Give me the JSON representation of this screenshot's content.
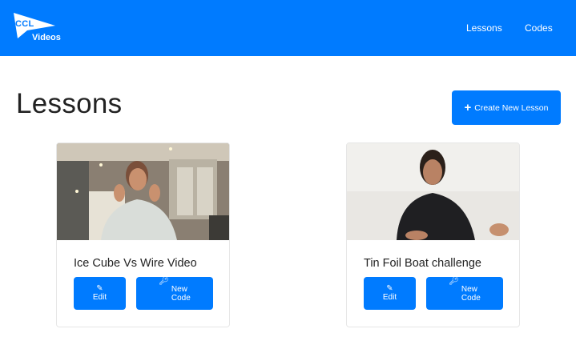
{
  "navbar": {
    "logo": {
      "top_text": "CCL",
      "bottom_text": "Videos",
      "icon": "pennant-logo"
    },
    "links": [
      {
        "label": "Lessons"
      },
      {
        "label": "Codes"
      }
    ],
    "background": "#007bff"
  },
  "page": {
    "title": "Lessons",
    "create_button": {
      "icon": "plus-icon",
      "label": "Create New Lesson"
    }
  },
  "lessons": [
    {
      "title": "Ice Cube Vs Wire Video",
      "thumbnail_icon": "video-thumbnail",
      "edit_button": {
        "icon": "edit-icon",
        "label": "Edit"
      },
      "code_button": {
        "icon": "key-icon",
        "line1": "New",
        "line2": "Code"
      }
    },
    {
      "title": "Tin Foil Boat challenge",
      "thumbnail_icon": "video-thumbnail",
      "edit_button": {
        "icon": "edit-icon",
        "label": "Edit"
      },
      "code_button": {
        "icon": "key-icon",
        "line1": "New",
        "line2": "Code"
      }
    }
  ],
  "colors": {
    "primary": "#007bff",
    "text": "#222222",
    "card_border": "#e6e6e6"
  }
}
